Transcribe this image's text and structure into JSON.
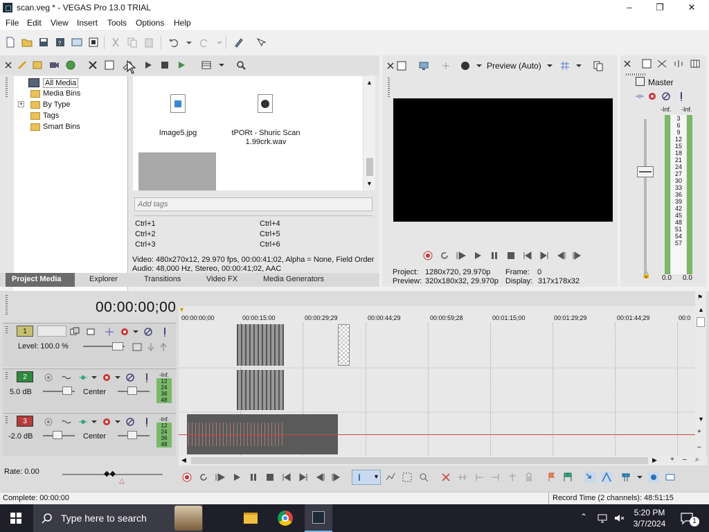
{
  "window": {
    "title": "scan.veg * - VEGAS Pro 13.0 TRIAL",
    "minimize_icon": "minimize-icon",
    "maximize_icon": "restore-icon",
    "close_icon": "close-icon"
  },
  "menu": [
    "File",
    "Edit",
    "View",
    "Insert",
    "Tools",
    "Options",
    "Help"
  ],
  "project_media": {
    "tree": [
      "All Media",
      "Media Bins",
      "By Type",
      "Tags",
      "Smart Bins"
    ],
    "tree_expand": "+",
    "files": [
      {
        "name": "Image5.jpg",
        "icon": "image-file-icon"
      },
      {
        "name": "tPORt - Shuric Scan 1.99crk.wav",
        "icon": "audio-file-icon"
      }
    ],
    "tags_placeholder": "Add tags",
    "shortcuts": [
      "Ctrl+1",
      "Ctrl+2",
      "Ctrl+3",
      "Ctrl+4",
      "Ctrl+5",
      "Ctrl+6"
    ],
    "info_video": "Video: 480x270x12, 29.970 fps, 00:00:41;02, Alpha = None, Field Order",
    "info_audio": "Audio: 48,000 Hz, Stereo, 00:00:41;02, AAC",
    "tabs": [
      "Project Media",
      "Explorer",
      "Transitions",
      "Video FX",
      "Media Generators"
    ]
  },
  "preview": {
    "mode": "Preview (Auto)",
    "project_label": "Project:",
    "project_value": "1280x720, 29.970p",
    "frame_label": "Frame:",
    "frame_value": "0",
    "preview_label": "Preview:",
    "preview_value": "320x180x32, 29.970p",
    "display_label": "Display:",
    "display_value": "317x178x32"
  },
  "master": {
    "title": "Master",
    "left_label": "-Inf.",
    "right_label": "-Inf.",
    "scale": [
      "3",
      "6",
      "9",
      "12",
      "15",
      "18",
      "21",
      "24",
      "27",
      "30",
      "33",
      "36",
      "39",
      "42",
      "45",
      "48",
      "51",
      "54",
      "57"
    ],
    "left_value": "0.0",
    "right_value": "0.0"
  },
  "timeline": {
    "timecode": "00:00:00;00",
    "ruler": [
      "00:00:00;00",
      "00:00:15:00",
      "00:00:29;29",
      "00:00:44;29",
      "00:00:59;28",
      "00:01:15;00",
      "00:01:29;29",
      "00:01:44;29",
      "00:0"
    ],
    "tracks": [
      {
        "num": "1",
        "type": "video",
        "level": "Level: 100.0 %"
      },
      {
        "num": "2",
        "type": "audio",
        "vol": "5.0 dB",
        "pan": "Center",
        "meter": [
          "-Inf.",
          "12",
          "24",
          "36",
          "48"
        ]
      },
      {
        "num": "3",
        "type": "audio",
        "vol": "-2.0 dB",
        "pan": "Center",
        "meter": [
          "-Inf.",
          "12",
          "24",
          "36",
          "48"
        ]
      }
    ],
    "rate": "Rate: 0.00"
  },
  "status": {
    "left": "Complete: 00:00:00",
    "right": "Record Time (2 channels): 48:51:15"
  },
  "taskbar": {
    "search_placeholder": "Type here to search",
    "time": "5:20 PM",
    "date": "3/7/2024",
    "notif_count": "1"
  },
  "colors": {
    "preview_bg": "#000000",
    "meter_green": "#7ab86a",
    "track2_badge": "#2e8a3e",
    "track3_badge": "#b43c3c",
    "accent": "#2f6fb5"
  }
}
